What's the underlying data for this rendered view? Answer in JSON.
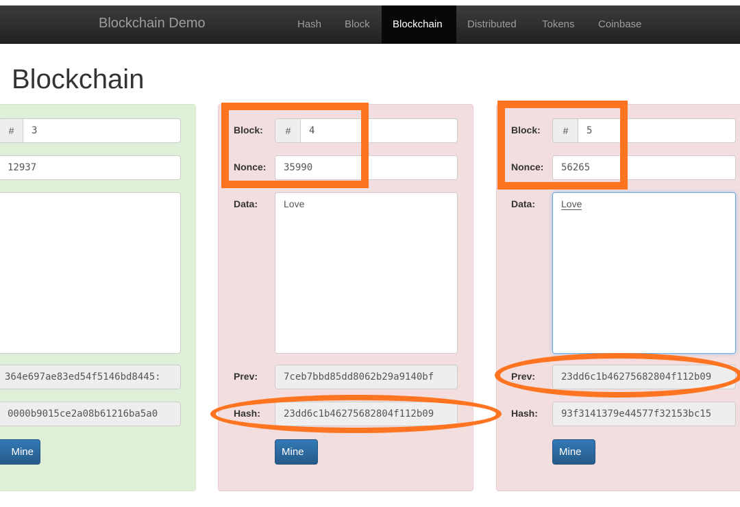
{
  "navbar": {
    "brand": "Blockchain Demo",
    "items": [
      {
        "label": "Hash",
        "active": false
      },
      {
        "label": "Block",
        "active": false
      },
      {
        "label": "Blockchain",
        "active": true
      },
      {
        "label": "Distributed",
        "active": false
      },
      {
        "label": "Tokens",
        "active": false
      },
      {
        "label": "Coinbase",
        "active": false
      }
    ]
  },
  "page": {
    "title": "Blockchain"
  },
  "labels": {
    "block": "Block:",
    "nonce": "Nonce:",
    "data": "Data:",
    "prev": "Prev:",
    "hash": "Hash:",
    "hash_symbol": "#",
    "mine": "Mine"
  },
  "blocks": [
    {
      "status": "valid",
      "number": "3",
      "nonce": "12937",
      "data": "",
      "prev": "364e697ae83ed54f5146bd8445:",
      "hash": "0000b9015ce2a08b61216ba5a0"
    },
    {
      "status": "invalid",
      "number": "4",
      "nonce": "35990",
      "data": "Love",
      "prev": "7ceb7bbd85dd8062b29a9140bf",
      "hash": "23dd6c1b46275682804f112b09"
    },
    {
      "status": "invalid",
      "number": "5",
      "nonce": "56265",
      "data": "Love",
      "prev": "23dd6c1b46275682804f112b09",
      "hash": "93f3141379e44577f32153bc15"
    }
  ],
  "colors": {
    "valid_panel": "#dff0d8",
    "invalid_panel": "#f2dede",
    "annotation": "#ff7420",
    "navbar": "#222222",
    "button": "#337ab7"
  }
}
